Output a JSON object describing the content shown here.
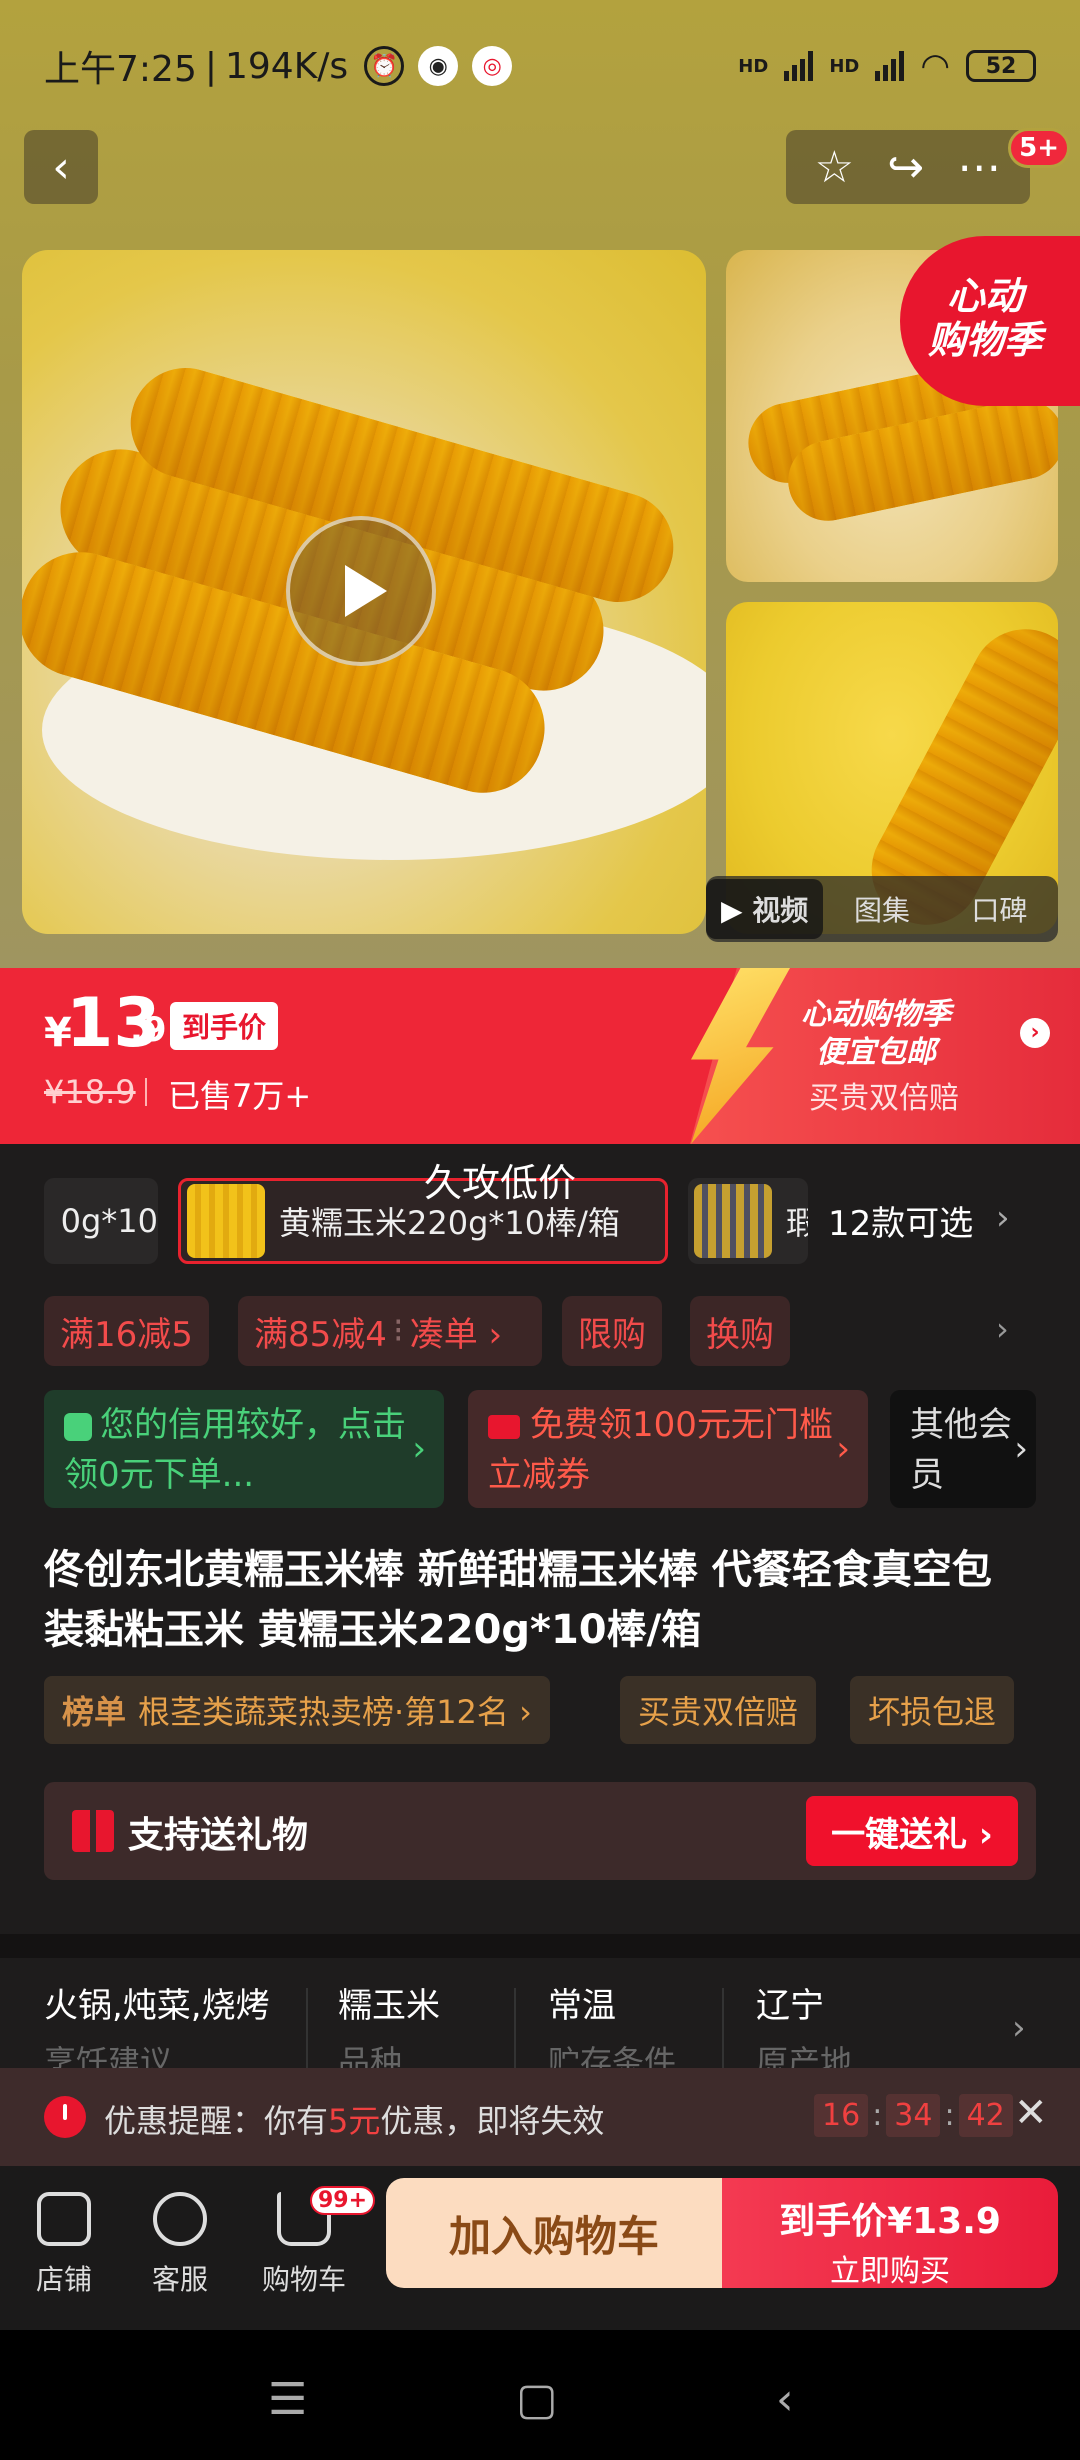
{
  "status_bar": {
    "time": "上午7:25",
    "net_speed": "194K/s",
    "signal1": "HD",
    "signal2": "HD",
    "battery": "52"
  },
  "top_nav": {
    "badge": "5+"
  },
  "gallery": {
    "promo_tag_line1": "心动",
    "promo_tag_line2": "购物季",
    "tabs": [
      "视频",
      "图集",
      "口碑"
    ],
    "active_tab": "视频"
  },
  "price": {
    "yen": "¥",
    "integer": "13",
    "decimal": ".9",
    "tag": "到手价",
    "original": "¥18.9",
    "sold": "已售7万+",
    "banner_title_line1": "心动购物季",
    "banner_title_line2": "便宜包邮",
    "banner_sub": "买贵双倍赔"
  },
  "watermark": "久攻低价",
  "sku": {
    "partial_left": "0g*10",
    "active_label": "黄糯玉米220g*10棒/箱",
    "partial_right": "瑕",
    "count": "12款可选"
  },
  "coupons": [
    "满16减5",
    "满85减4",
    "凑单 ›",
    "限购",
    "换购"
  ],
  "credit": {
    "green": "您的信用较好，点击领0元下单...",
    "red": "免费领100元无门槛立减券",
    "dark": "其他会员"
  },
  "title": "佟创东北黄糯玉米棒 新鲜甜糯玉米棒 代餐轻食真空包装黏粘玉米 黄糯玉米220g*10棒/箱",
  "tags": {
    "rank_label": "榜单",
    "rank_text": "根茎类蔬菜热卖榜·第12名 ›",
    "t2": "买贵双倍赔",
    "t3": "坏损包退"
  },
  "gift": {
    "text": "支持送礼物",
    "button": "一键送礼 ›"
  },
  "attributes": [
    {
      "value": "火锅,炖菜,烧烤",
      "label": "烹饪建议"
    },
    {
      "value": "糯玉米",
      "label": "品种"
    },
    {
      "value": "常温",
      "label": "贮存条件"
    },
    {
      "value": "辽宁",
      "label": "原产地"
    }
  ],
  "reminder": {
    "prefix": "优惠提醒：你有",
    "amount": "5元",
    "suffix": "优惠，即将失效",
    "hh": "16",
    "mm": "34",
    "ss": "42"
  },
  "bottom": {
    "shop": "店铺",
    "service": "客服",
    "cart": "购物车",
    "cart_badge": "99+",
    "add_cart": "加入购物车",
    "buy_line1": "到手价¥13.9",
    "buy_line2": "立即购买"
  },
  "colors": {
    "accent_red": "#e8162e",
    "header_gold": "#b3a23e"
  }
}
